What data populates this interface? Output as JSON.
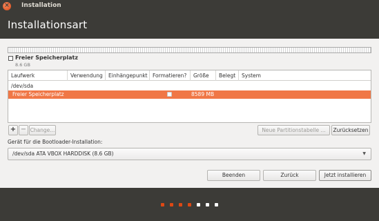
{
  "window": {
    "title": "Installation"
  },
  "page": {
    "title": "Installationsart"
  },
  "legend": {
    "label": "Freier Speicherplatz",
    "size": "8.6 GB"
  },
  "table": {
    "headers": [
      "Laufwerk",
      "Verwendung",
      "Einhängepunkt",
      "Formatieren?",
      "Größe",
      "Belegt",
      "System"
    ],
    "device_row": "/dev/sda",
    "free_row": {
      "name": "Freier Speicherplatz",
      "size": "8589 MB"
    }
  },
  "buttons": {
    "add": "+",
    "remove": "−",
    "change": "Change...",
    "new_table": "Neue Partitionstabelle ...",
    "reset": "Zurücksetzen",
    "quit": "Beenden",
    "back": "Zurück",
    "install": "Jetzt installieren"
  },
  "bootloader": {
    "label": "Gerät für die Bootloader-Installation:",
    "selected": "/dev/sda  ATA VBOX HARDDISK (8.6 GB)"
  },
  "progress": {
    "total_steps": 7,
    "completed_steps": 4,
    "colors": {
      "active": "#dd4814",
      "inactive": "#ffffff"
    }
  },
  "colors": {
    "accent": "#f07746",
    "header_bg": "#3c3b37",
    "panel_bg": "#f2f1f0"
  }
}
